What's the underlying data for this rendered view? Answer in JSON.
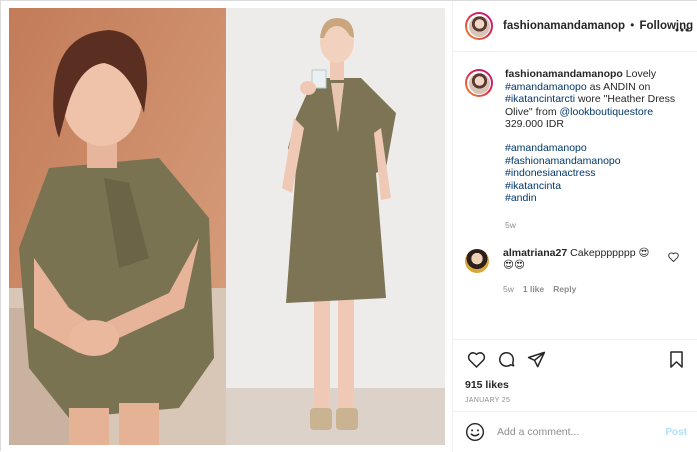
{
  "post": {
    "images": [
      {
        "name": "left-photo",
        "alt": ""
      },
      {
        "name": "right-photo",
        "alt": ""
      }
    ]
  },
  "header": {
    "username": "fashionamandamanop",
    "separator": "•",
    "follow_label": "Following",
    "more_icon": "more-icon"
  },
  "caption": {
    "username": "fashionamandamanopo",
    "text_1": "Lovely",
    "mention_1": "#amandamanopo",
    "text_2": "as ANDIN on",
    "hashtag_1": "#ikatancintarcti",
    "text_3": "wore \"Heather Dress Olive\" from",
    "mention_2": "@lookboutiquestore",
    "price": "329.000 IDR",
    "tags": [
      "#amandamanopo",
      "#fashionamandamanopo",
      "#indonesianactress",
      "#ikatancinta",
      "#andin"
    ],
    "time": "5w"
  },
  "comment": {
    "username": "almatriana27",
    "text": "Cakeppppppp 😍😍😍",
    "time": "5w",
    "likes": "1 like",
    "reply": "Reply"
  },
  "actions": {
    "likes": "915 likes",
    "date": "JANUARY 25"
  },
  "composer": {
    "placeholder": "Add a comment...",
    "post_label": "Post"
  },
  "colors": {
    "link": "#00376b",
    "muted": "#8e8e8e",
    "post_disabled": "#b2dffc"
  }
}
